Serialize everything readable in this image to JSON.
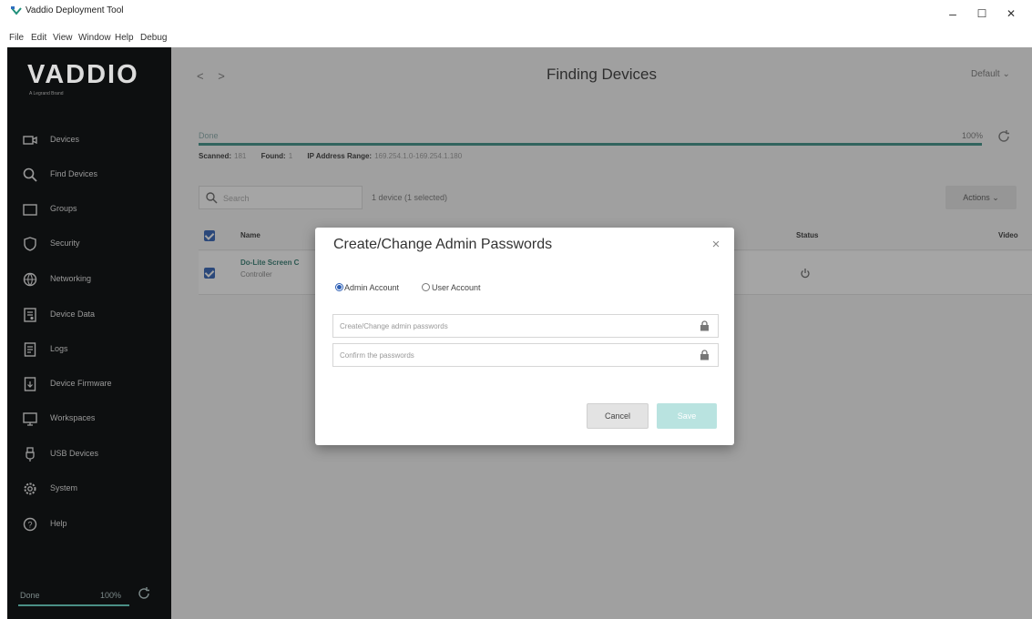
{
  "window": {
    "title": "Vaddio Deployment Tool",
    "minimize": "–",
    "maximize": "☐",
    "close": "✕"
  },
  "menu": [
    "File",
    "Edit",
    "View",
    "Window",
    "Help",
    "Debug"
  ],
  "sidebar": {
    "logo": "VADDIO",
    "tagline": "A Legrand Brand",
    "items": [
      {
        "label": "Devices",
        "icon": "camera-icon"
      },
      {
        "label": "Find Devices",
        "icon": "search-icon"
      },
      {
        "label": "Groups",
        "icon": "folder-icon"
      },
      {
        "label": "Security",
        "icon": "shield-icon"
      },
      {
        "label": "Networking",
        "icon": "globe-icon"
      },
      {
        "label": "Device Data",
        "icon": "device-data-icon"
      },
      {
        "label": "Logs",
        "icon": "document-icon"
      },
      {
        "label": "Device Firmware",
        "icon": "firmware-icon"
      },
      {
        "label": "Workspaces",
        "icon": "monitor-icon"
      },
      {
        "label": "USB Devices",
        "icon": "usb-icon"
      },
      {
        "label": "System",
        "icon": "gear-icon"
      },
      {
        "label": "Help",
        "icon": "help-icon"
      }
    ],
    "status": "Done",
    "percent": "100%"
  },
  "main": {
    "title": "Finding Devices",
    "nav_arrows": "< >",
    "view_select": "Default ⌄",
    "progress": {
      "status": "Done",
      "percent": "100%",
      "scanned_label": "Scanned:",
      "scanned_value": "181",
      "found_label": "Found:",
      "found_value": "1",
      "range_label": "IP Address Range:",
      "range_value": "169.254.1.0-169.254.1.180"
    },
    "search_placeholder": "Search",
    "device_count": "1 device (1 selected)",
    "actions_label": "Actions ⌄",
    "table": {
      "columns": [
        "Name",
        "Status",
        "Video"
      ],
      "rows": [
        {
          "name": "Do-Lite Screen C",
          "type": "Controller"
        }
      ]
    }
  },
  "dialog": {
    "title": "Create/Change Admin Passwords",
    "close": "×",
    "radio_admin": "Admin Account",
    "radio_user": "User Account",
    "password_placeholder": "Create/Change admin passwords",
    "confirm_placeholder": "Confirm the passwords",
    "cancel_label": "Cancel",
    "save_label": "Save"
  },
  "colors": {
    "sidebar_bg": "#0d0f10",
    "accent": "#3a8f85",
    "checkbox": "#2d5fb5",
    "save_disabled": "#b9e3e0"
  }
}
